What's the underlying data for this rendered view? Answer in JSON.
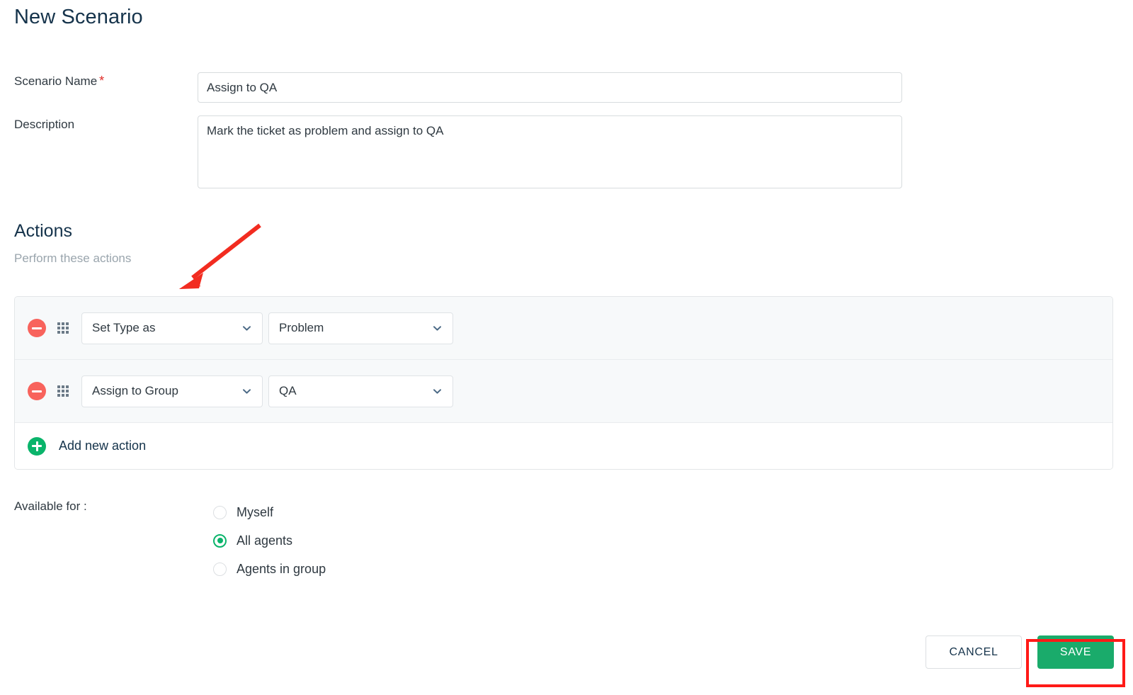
{
  "page": {
    "title": "New Scenario"
  },
  "form": {
    "scenario_name": {
      "label": "Scenario Name",
      "required_marker": "*",
      "value": "Assign to QA",
      "placeholder": ""
    },
    "description": {
      "label": "Description",
      "value": "Mark the ticket as problem and assign to QA",
      "placeholder": ""
    }
  },
  "actions": {
    "heading": "Actions",
    "subheading": "Perform these actions",
    "rows": [
      {
        "remove_icon": "minus-circle-icon",
        "drag_icon": "drag-handle-icon",
        "action_select": "Set Type as",
        "value_select": "Problem",
        "chevron_icon": "chevron-down-icon"
      },
      {
        "remove_icon": "minus-circle-icon",
        "drag_icon": "drag-handle-icon",
        "action_select": "Assign to Group",
        "value_select": "QA",
        "chevron_icon": "chevron-down-icon"
      }
    ],
    "add_new": {
      "icon": "plus-circle-icon",
      "label": "Add new action"
    }
  },
  "availability": {
    "label": "Available for :",
    "options": [
      {
        "label": "Myself",
        "selected": false
      },
      {
        "label": "All agents",
        "selected": true
      },
      {
        "label": "Agents in group",
        "selected": false
      }
    ]
  },
  "footer": {
    "cancel_label": "CANCEL",
    "save_label": "SAVE"
  },
  "annotations": {
    "arrow": {
      "icon": "red-arrow-annotation",
      "color": "#f22c20"
    },
    "save_highlight": {
      "icon": "red-rectangle-highlight",
      "color": "#ff1a17"
    }
  },
  "colors": {
    "title": "#15334b",
    "text": "#2f3941",
    "muted": "#9aa5ad",
    "border": "#d8dcde",
    "row_bg": "#f7f9fa",
    "danger": "#f8635c",
    "success": "#0ab46b",
    "save_green": "#1aab6b",
    "required_star": "#e02b27",
    "annotation_red": "#ff1a17"
  }
}
